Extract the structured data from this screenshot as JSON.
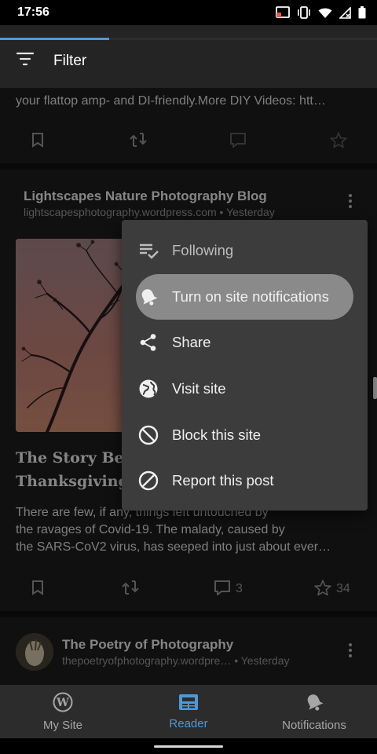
{
  "status_bar": {
    "time": "17:56"
  },
  "app_bar": {
    "filter_label": "Filter",
    "progress": 0.29
  },
  "card1": {
    "excerpt": "your flattop amp- and DI-friendly.More DIY Videos: htt…"
  },
  "card2": {
    "blog_name": "Lightscapes Nature Photography Blog",
    "blog_meta": "lightscapesphotography.wordpress.com • Yesterday",
    "title_lines": [
      "The Story Behind the Unpaved",
      "Thanksgiving"
    ],
    "excerpt_lines": [
      "There are few, if any, things left untouched by",
      "the ravages of Covid-19.  The malady, caused by",
      "the SARS-CoV2 virus, has seeped into just about ever…"
    ],
    "comments": "3",
    "likes": "34"
  },
  "card3": {
    "blog_name": "The Poetry of Photography",
    "blog_meta": "thepoetryofphotography.wordpre… • Yesterday"
  },
  "menu": {
    "items": [
      {
        "label": "Following",
        "icon": "following-check-icon"
      },
      {
        "label": "Turn on site notifications",
        "icon": "bell-icon"
      },
      {
        "label": "Share",
        "icon": "share-icon"
      },
      {
        "label": "Visit site",
        "icon": "globe-icon"
      },
      {
        "label": "Block this site",
        "icon": "block-icon"
      },
      {
        "label": "Report this post",
        "icon": "report-icon"
      }
    ]
  },
  "bottom_nav": {
    "items": [
      {
        "label": "My Site",
        "icon": "wordpress-icon"
      },
      {
        "label": "Reader",
        "icon": "reader-icon"
      },
      {
        "label": "Notifications",
        "icon": "bell-icon"
      }
    ],
    "active": "Reader"
  },
  "colors": {
    "accent": "#4f98d8",
    "menu_bg": "#3c3c3c",
    "card_bg": "#1e1e1e",
    "highlight": "#8a8a8a"
  }
}
